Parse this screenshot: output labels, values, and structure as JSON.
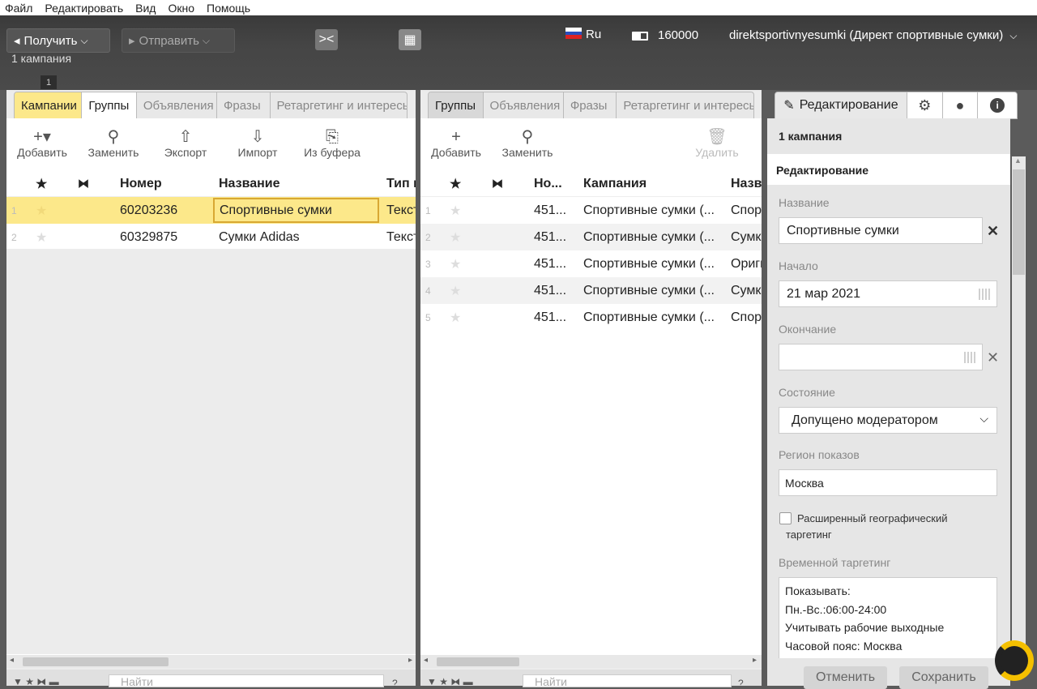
{
  "menu": [
    "Файл",
    "Редактировать",
    "Вид",
    "Окно",
    "Помощь"
  ],
  "toolbar": {
    "get_label": "Получить",
    "send_label": "Отправить",
    "campaign_count": "1 кампания",
    "lang": "Ru",
    "balance": "160000",
    "account": "direktsportivnyesumki (Директ спортивные сумки)",
    "badge": "1"
  },
  "left": {
    "tabs": [
      "Кампании",
      "Группы",
      "Объявления",
      "Фразы",
      "Ретаргетинг и интересы"
    ],
    "tools": [
      "Добавить",
      "Заменить",
      "Экспорт",
      "Импорт",
      "Из буфера"
    ],
    "headers": [
      "Номер",
      "Название",
      "Тип к"
    ],
    "rows": [
      {
        "n": "1",
        "num": "60203236",
        "name": "Спортивные сумки",
        "type": "Текст"
      },
      {
        "n": "2",
        "num": "60329875",
        "name": "Сумки Adidas",
        "type": "Текст"
      }
    ],
    "search_placeholder": "Найти"
  },
  "mid": {
    "tabs": [
      "Группы",
      "Объявления",
      "Фразы",
      "Ретаргетинг и интересы"
    ],
    "tools": [
      "Добавить",
      "Заменить",
      "Удалить"
    ],
    "headers": [
      "Но...",
      "Кампания",
      "Назв"
    ],
    "rows": [
      {
        "n": "1",
        "num": "451...",
        "camp": "Спортивные сумки (...",
        "name": "Спорт"
      },
      {
        "n": "2",
        "num": "451...",
        "camp": "Спортивные сумки (...",
        "name": "Сумк"
      },
      {
        "n": "3",
        "num": "451...",
        "camp": "Спортивные сумки (...",
        "name": "Ориги"
      },
      {
        "n": "4",
        "num": "451...",
        "camp": "Спортивные сумки (...",
        "name": "Сумк"
      },
      {
        "n": "5",
        "num": "451...",
        "camp": "Спортивные сумки (...",
        "name": "Спорт"
      }
    ],
    "search_placeholder": "Найти"
  },
  "side": {
    "tab_edit": "Редактирование",
    "count": "1 кампания",
    "section": "Редактирование",
    "name_label": "Название",
    "name_value": "Спортивные сумки",
    "start_label": "Начало",
    "start_value": "21 мар 2021",
    "end_label": "Окончание",
    "end_value": "",
    "state_label": "Состояние",
    "state_value": "Допущено модератором",
    "region_label": "Регион показов",
    "region_value": "Москва",
    "geo_label": "Расширенный географический таргетинг",
    "time_label": "Временной таргетинг",
    "time_lines": [
      "Показывать:",
      "Пн.-Вс.:06:00-24:00",
      "Учитывать рабочие выходные",
      "Часовой пояс: Москва"
    ],
    "cancel": "Отменить",
    "save": "Сохранить"
  }
}
